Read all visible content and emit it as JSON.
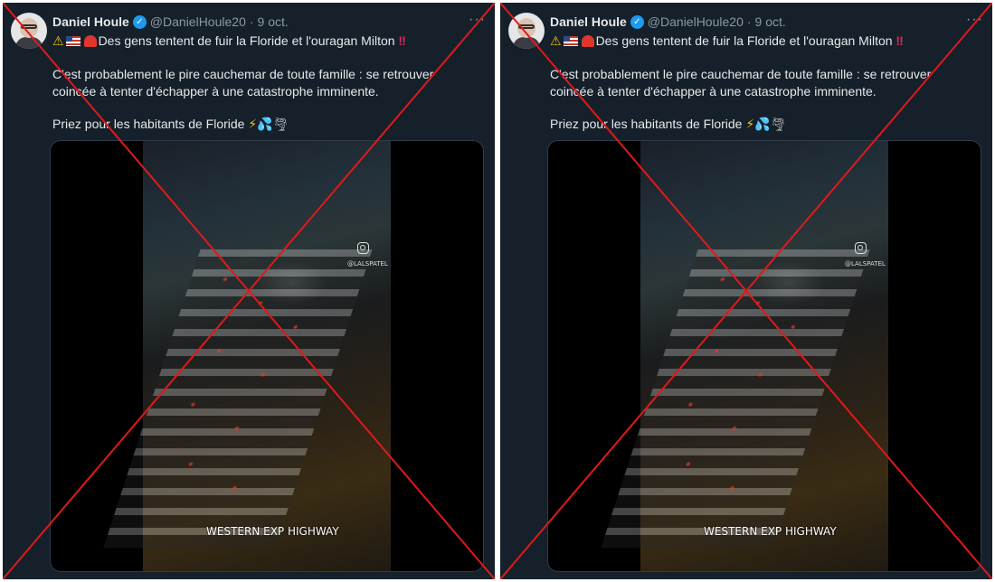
{
  "colors": {
    "background": "#15202b",
    "text": "#e7e9ea",
    "secondary": "#8b98a5",
    "verified": "#1d9bf0",
    "cross": "#e0191a"
  },
  "tweets": [
    {
      "author": {
        "name": "Daniel Houle",
        "handle": "@DanielHoule20",
        "verified_icon": "verified-badge-icon"
      },
      "separator": "·",
      "date": "9 oct.",
      "more": "···",
      "line1": "Des gens tentent de fuir la Floride et l'ouragan Milton",
      "line2": "C'est probablement le pire cauchemar de toute famille : se retrouver",
      "line3": "coincée à tenter d'échapper à une catastrophe imminente.",
      "line4": "Priez pour les habitants de Floride",
      "video": {
        "watermark": "@LALSPATEL",
        "caption": "WESTERN EXP HIGHWAY"
      }
    },
    {
      "author": {
        "name": "Daniel Houle",
        "handle": "@DanielHoule20",
        "verified_icon": "verified-badge-icon"
      },
      "separator": "·",
      "date": "9 oct.",
      "more": "···",
      "line1": "Des gens tentent de fuir la Floride et l'ouragan Milton",
      "line2": "C'est probablement le pire cauchemar de toute famille : se retrouver",
      "line3": "coincée à tenter d'échapper à une catastrophe imminente.",
      "line4": "Priez pour les habitants de Floride",
      "video": {
        "watermark": "@LALSPATEL",
        "caption": "WESTERN EXP HIGHWAY"
      }
    }
  ]
}
